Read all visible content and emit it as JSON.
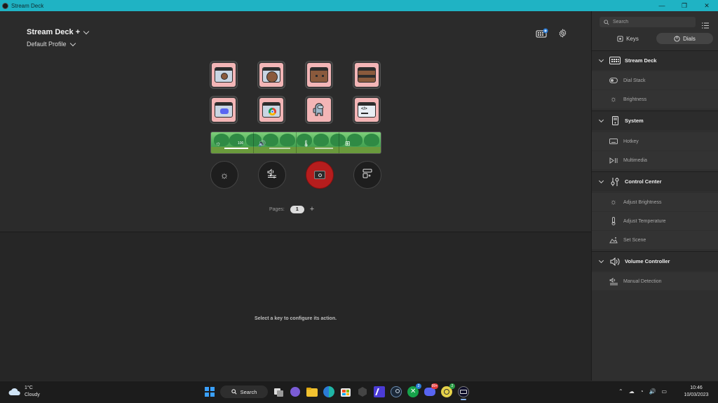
{
  "window": {
    "title": "Stream Deck",
    "minimize": "—",
    "maximize": "❐",
    "close": "✕"
  },
  "header": {
    "device": "Stream Deck +",
    "profile": "Default Profile"
  },
  "touch_strip": {
    "brightness_value": "100"
  },
  "pages": {
    "label": "Pages:",
    "current": "1",
    "add": "+"
  },
  "inspector": {
    "hint": "Select a key to configure its action."
  },
  "sidebar": {
    "search_placeholder": "Search",
    "tabs": [
      {
        "label": "Keys"
      },
      {
        "label": "Dials"
      }
    ],
    "groups": [
      {
        "label": "Stream Deck",
        "items": [
          "Dial Stack",
          "Brightness"
        ]
      },
      {
        "label": "System",
        "items": [
          "Hotkey",
          "Multimedia"
        ]
      },
      {
        "label": "Control Center",
        "items": [
          "Adjust Brightness",
          "Adjust Temperature",
          "Set Scene"
        ]
      },
      {
        "label": "Volume Controller",
        "items": [
          "Manual Detection"
        ]
      }
    ]
  },
  "taskbar": {
    "weather_temp": "1°C",
    "weather_desc": "Cloudy",
    "search_label": "Search",
    "time": "10:46",
    "date": "10/03/2023",
    "badges": {
      "discord": "2",
      "messenger": "99+",
      "app": "2"
    }
  },
  "colors": {
    "titlebar": "#1fb3c4",
    "key_bg": "#f3b5b6",
    "dial_active": "#b51d1d"
  }
}
